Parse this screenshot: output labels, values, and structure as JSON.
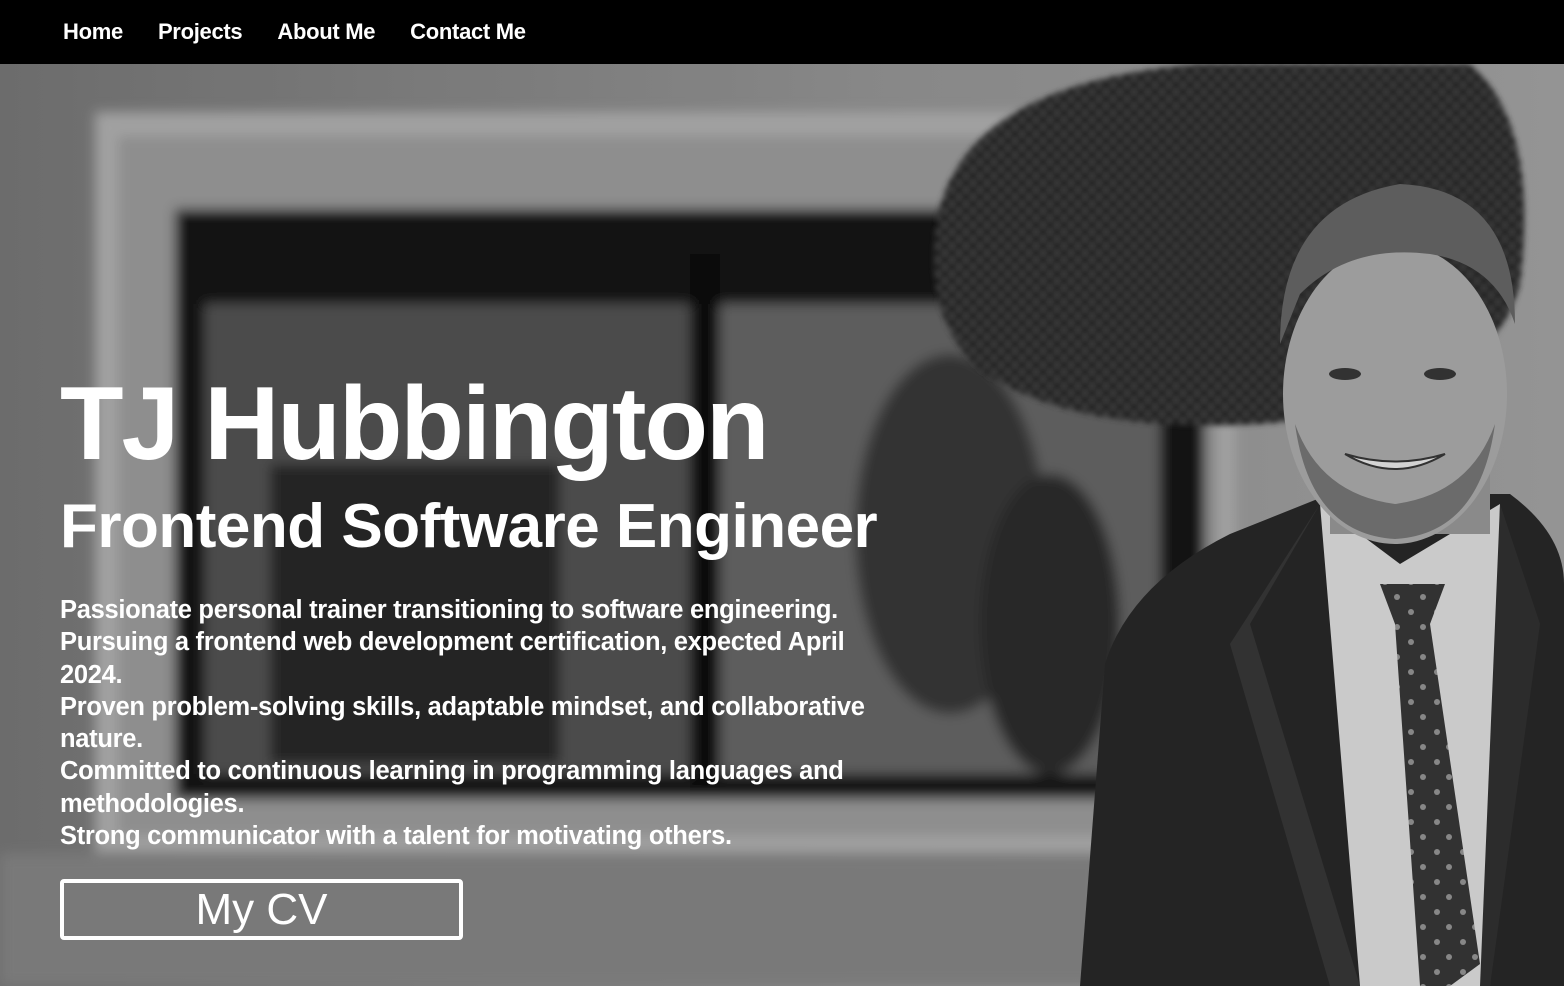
{
  "nav": {
    "items": [
      {
        "label": "Home"
      },
      {
        "label": "Projects"
      },
      {
        "label": "About Me"
      },
      {
        "label": "Contact Me"
      }
    ]
  },
  "hero": {
    "name": "TJ Hubbington",
    "role": "Frontend Software Engineer",
    "bio": [
      "Passionate personal trainer transitioning to software engineering.",
      "Pursuing a frontend web development certification, expected April 2024.",
      "Proven problem-solving skills, adaptable mindset, and collaborative nature.",
      "Committed to continuous learning in programming languages and methodologies.",
      "Strong communicator with a talent for motivating others."
    ],
    "cta_label": "My CV"
  },
  "colors": {
    "nav_background": "#000000",
    "text": "#ffffff",
    "photo_tone": "grayscale"
  }
}
